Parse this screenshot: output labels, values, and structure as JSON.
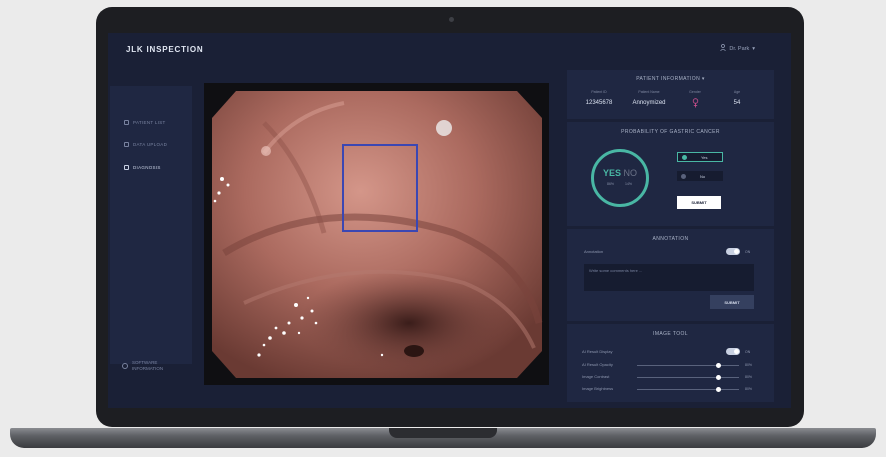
{
  "app": {
    "logo": "JLK INSPECTION",
    "user": "Dr. Park"
  },
  "sidebar": {
    "items": [
      {
        "label": "PATIENT LIST",
        "icon": "list-icon"
      },
      {
        "label": "DATA UPLOAD",
        "icon": "upload-icon"
      },
      {
        "label": "DIAGNOSIS",
        "icon": "diagnosis-icon"
      }
    ],
    "footer_line1": "SOFTWARE",
    "footer_line2": "INFORMATION"
  },
  "patient": {
    "title": "PATIENT INFORMATION",
    "headers": [
      "Patient ID",
      "Patient Name",
      "Gender",
      "Age"
    ],
    "id": "12345678",
    "name": "Annoymized",
    "gender_icon": "female-icon",
    "age": "54"
  },
  "probability": {
    "title": "PROBABILITY OF GASTRIC CANCER",
    "yes": "YES",
    "no": "NO",
    "yes_pct": "86%",
    "no_pct": "14%",
    "yes_fraction": 0.86,
    "option_yes": "Yes",
    "option_no": "No",
    "submit": "SUBMIT"
  },
  "annotation": {
    "title": "ANNOTATION",
    "label": "Annotation",
    "toggle": "ON",
    "placeholder": "Write some comments here ...",
    "submit": "SUBMIT"
  },
  "image_tool": {
    "title": "IMAGE TOOL",
    "ai_display_label": "AI Result Display",
    "ai_display_toggle": "ON",
    "sliders": [
      {
        "label": "AI Result Opacity",
        "value": "80%",
        "level": 0.8
      },
      {
        "label": "Image Contrast",
        "value": "80%",
        "level": 0.8
      },
      {
        "label": "Image Brightness",
        "value": "80%",
        "level": 0.8
      }
    ]
  },
  "colors": {
    "accent_teal": "#49b7a4",
    "roi_box": "#3b47b3",
    "panel": "#1f2742",
    "screen_bg": "#1a2036"
  }
}
